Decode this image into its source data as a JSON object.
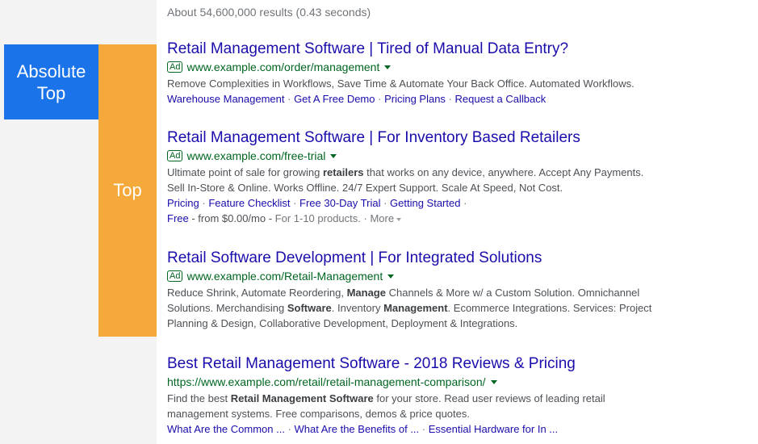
{
  "stats": "About 54,600,000 results (0.43 seconds)",
  "labels": {
    "absolute_top_line1": "Absolute",
    "absolute_top_line2": "Top",
    "top": "Top"
  },
  "results": [
    {
      "title": "Retail Management Software | Tired of Manual Data Entry?",
      "ad": "Ad",
      "url": "www.example.com/order/management",
      "desc_lines": [
        "Remove Complexities in Workflows, Save Time & Automate Your Back Office. Automated Workflows."
      ],
      "links": [
        "Warehouse Management",
        "Get A Free Demo",
        "Pricing Plans",
        "Request a Callback"
      ]
    },
    {
      "title": "Retail Management Software | For Inventory Based Retailers",
      "ad": "Ad",
      "url": "www.example.com/free-trial",
      "desc_line1_pre": "Ultimate point of sale for growing ",
      "desc_line1_bold": "retailers",
      "desc_line1_post": " that works on any device, anywhere. Accept Any Payments.",
      "desc_line2": "Sell In-Store & Online. Works Offline. 24/7 Expert Support. Scale At Speed, Not Cost.",
      "links": [
        "Pricing",
        "Feature Checklist",
        "Free 30-Day Trial",
        "Getting Started"
      ],
      "price_link": "Free",
      "price_text": " - from $0.00/mo - ",
      "price_note": "For 1-10 products.",
      "more": "More"
    },
    {
      "title": "Retail Software Development | For Integrated Solutions",
      "ad": "Ad",
      "url": "www.example.com/Retail-Management",
      "d1a": "Reduce Shrink, Automate Reordering, ",
      "d1b": "Manage",
      "d1c": " Channels & More w/ a Custom Solution. Omnichannel",
      "d2a": "Solutions. Merchandising ",
      "d2b": "Software",
      "d2c": ". Inventory ",
      "d2d": "Management",
      "d2e": ". Ecommerce Integrations. Services: Project",
      "d3": "Planning & Design, Collaborative Development, Deployment & Integrations."
    },
    {
      "title": "Best Retail Management Software - 2018 Reviews & Pricing",
      "url": "https://www.example.com/retail/retail-management-comparison/",
      "d1a": "Find the best ",
      "d1b": "Retail Management Software",
      "d1c": " for your store. Read user reviews of leading retail",
      "d2": "management systems. Free comparisons, demos & price quotes.",
      "links": [
        "What Are the Common ...",
        "What Are the Benefits of ...",
        "Essential Hardware for In ..."
      ]
    }
  ],
  "sep": " · "
}
